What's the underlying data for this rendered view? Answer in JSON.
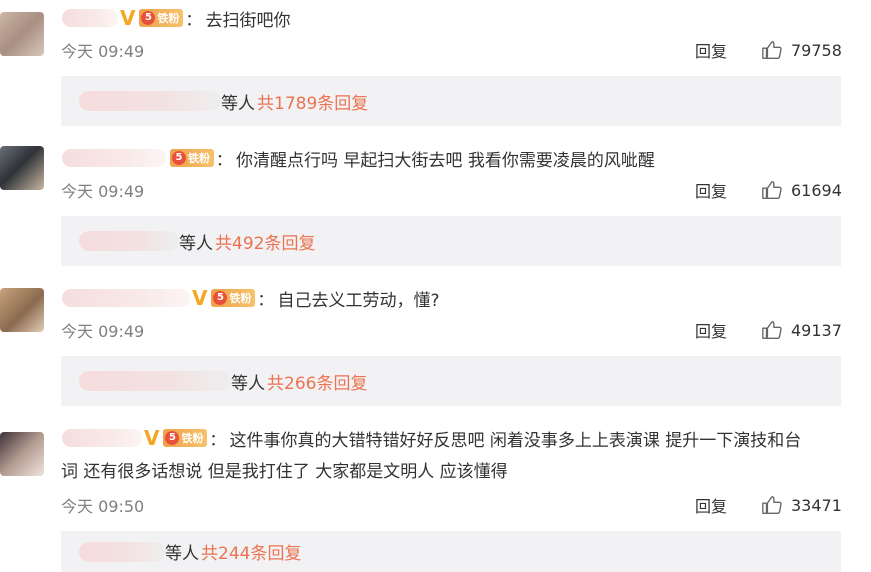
{
  "comments": [
    {
      "fan_badge_text": "铁粉",
      "verified_badge": "V",
      "text": "去扫街吧你",
      "time": "今天 09:49",
      "reply_label": "回复",
      "likes": "79758",
      "replies": {
        "suffix": "等人",
        "link": "共1789条回复"
      }
    },
    {
      "fan_badge_text": "铁粉",
      "text": "你清醒点行吗 早起扫大街去吧 我看你需要凌晨的风呲醒",
      "time": "今天 09:49",
      "reply_label": "回复",
      "likes": "61694",
      "replies": {
        "suffix": "等人",
        "link": "共492条回复"
      }
    },
    {
      "fan_badge_text": "铁粉",
      "verified_badge": "V",
      "text": "自己去义工劳动，懂?",
      "time": "今天 09:49",
      "reply_label": "回复",
      "likes": "49137",
      "replies": {
        "suffix": "等人",
        "link": "共266条回复"
      }
    },
    {
      "fan_badge_text": "铁粉",
      "verified_badge": "V",
      "text_line1": "这件事你真的大错特错好好反思吧 闲着没事多上上表演课 提升一下演技和台",
      "text_line2": "词 还有很多话想说 但是我打住了 大家都是文明人 应该懂得",
      "time": "今天 09:50",
      "reply_label": "回复",
      "likes": "33471",
      "replies": {
        "suffix": "等人",
        "link": "共244条回复"
      }
    }
  ],
  "colors": {
    "link": "#eb7350",
    "timestamp": "#808080",
    "reply_bg": "#f2f2f5",
    "badge": "#f5a623"
  },
  "icons": {
    "like": "thumbs-up-icon",
    "verified": "verified-v-icon",
    "fan": "fan-badge-icon"
  }
}
